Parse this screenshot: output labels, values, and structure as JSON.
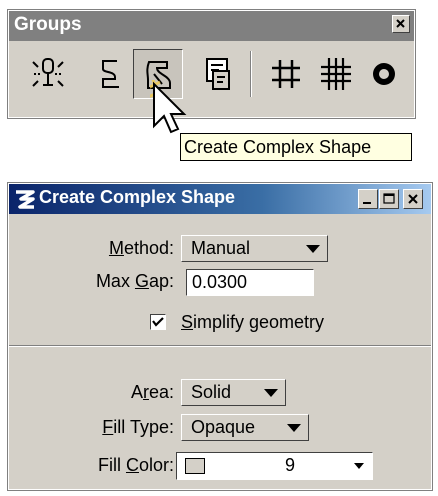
{
  "groups_toolbox": {
    "title": "Groups",
    "close_glyph": "×",
    "tools": [
      {
        "name": "drop-element-icon"
      },
      {
        "name": "create-complex-chain-icon"
      },
      {
        "name": "create-complex-shape-icon",
        "active": true
      },
      {
        "name": "create-region-icon"
      },
      {
        "name": "add-to-graphic-group-icon"
      },
      {
        "name": "drop-from-graphic-group-icon"
      },
      {
        "name": "group-holes-icon"
      }
    ]
  },
  "tooltip": {
    "text": "Create Complex Shape"
  },
  "dialog": {
    "title": "Create Complex Shape",
    "method": {
      "label_ul": "M",
      "label_rest": "ethod:",
      "value": "Manual"
    },
    "max_gap": {
      "label_pre": "Max ",
      "label_ul": "G",
      "label_rest": "ap:",
      "value": "0.0300"
    },
    "simplify": {
      "label_ul": "S",
      "label_rest": "implify geometry",
      "checked": true
    },
    "area": {
      "label_pre": "A",
      "label_ul": "r",
      "label_rest": "ea:",
      "value": "Solid"
    },
    "fill_type": {
      "label_ul": "F",
      "label_rest": "ill Type:",
      "value": "Opaque"
    },
    "fill_color": {
      "label_pre": "Fill ",
      "label_ul": "C",
      "label_rest": "olor:",
      "value": "9",
      "swatch": "#d4d0c8"
    }
  },
  "colors": {
    "title_bar_start": "#0a246a",
    "title_bar_end": "#a6caf0",
    "face": "#d4d0c8",
    "tooltip_bg": "#ffffe1"
  }
}
